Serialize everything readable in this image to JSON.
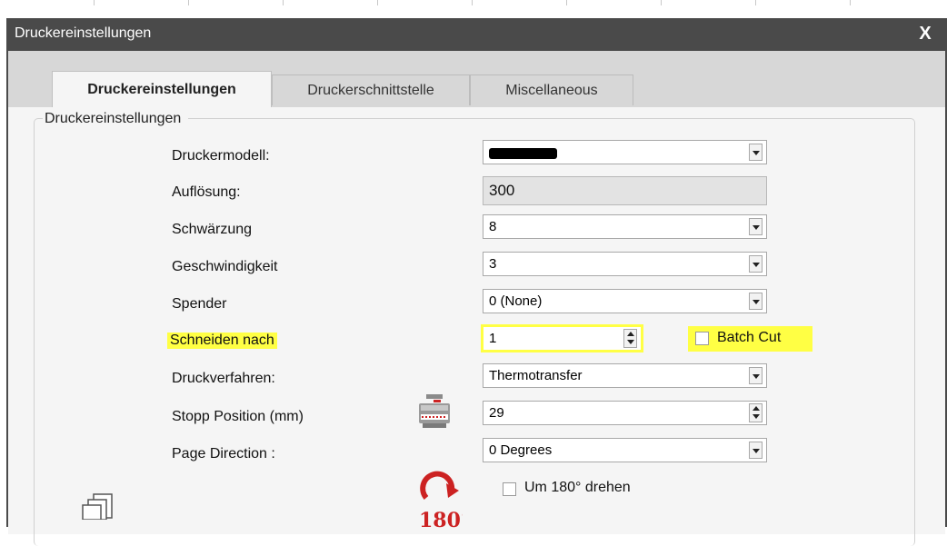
{
  "window": {
    "title": "Druckereinstellungen",
    "close_label": "X"
  },
  "tabs": [
    {
      "label": "Druckereinstellungen",
      "active": true
    },
    {
      "label": "Druckerschnittstelle",
      "active": false
    },
    {
      "label": "Miscellaneous",
      "active": false
    }
  ],
  "group": {
    "title": "Druckereinstellungen"
  },
  "fields": {
    "model": {
      "label": "Druckermodell:",
      "value": "[redacted]"
    },
    "resolution": {
      "label": "Auflösung:",
      "value": "300"
    },
    "darkness": {
      "label": "Schwärzung",
      "value": "8"
    },
    "speed": {
      "label": "Geschwindigkeit",
      "value": "3"
    },
    "dispenser": {
      "label": "Spender",
      "value": "0 (None)"
    },
    "cut_after": {
      "label": "Schneiden nach",
      "value": "1"
    },
    "batch_cut": {
      "label": "Batch Cut",
      "checked": false
    },
    "method": {
      "label": "Druckverfahren:",
      "value": "Thermotransfer"
    },
    "stop_pos": {
      "label": "Stopp Position (mm)",
      "value": "29"
    },
    "page_dir": {
      "label": "Page Direction :",
      "value": "0 Degrees"
    },
    "rotate": {
      "label": "Um 180° drehen",
      "checked": false
    }
  },
  "icons": {
    "printer_stop": "printer-icon",
    "rotate_180": "rotate-180-icon",
    "rotate_180_text": "180°",
    "copies": "pages-icon"
  },
  "colors": {
    "highlight": "#ffff44",
    "titlebar": "#4a4a4a",
    "accent_red": "#cc2222"
  }
}
